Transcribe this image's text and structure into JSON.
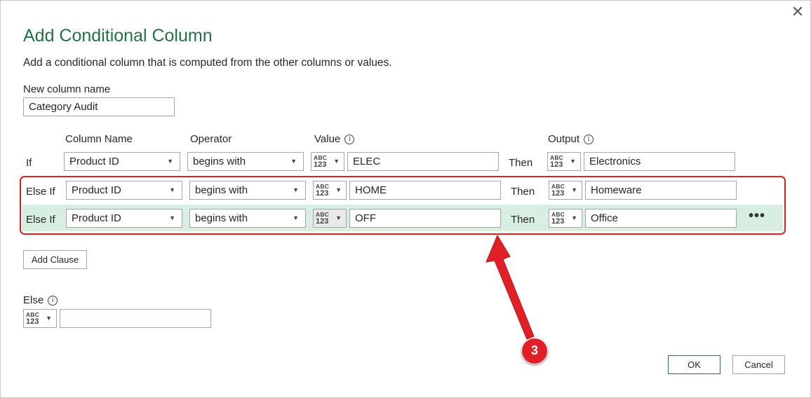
{
  "dialog": {
    "title": "Add Conditional Column",
    "subtitle": "Add a conditional column that is computed from the other columns or values.",
    "close_icon": "close-icon"
  },
  "new_column": {
    "label": "New column name",
    "value": "Category Audit"
  },
  "headers": {
    "column_name": "Column Name",
    "operator": "Operator",
    "value": "Value",
    "output": "Output",
    "info_glyph": "i"
  },
  "type_button": {
    "abc": "ABC",
    "num": "123"
  },
  "clauses": [
    {
      "prefix": "If",
      "column": "Product ID",
      "operator": "begins with",
      "value": "ELEC",
      "then": "Then",
      "output": "Electronics"
    },
    {
      "prefix": "Else If",
      "column": "Product ID",
      "operator": "begins with",
      "value": "HOME",
      "then": "Then",
      "output": "Homeware"
    },
    {
      "prefix": "Else If",
      "column": "Product ID",
      "operator": "begins with",
      "value": "OFF",
      "then": "Then",
      "output": "Office"
    }
  ],
  "more_options": "•••",
  "add_clause_label": "Add Clause",
  "else": {
    "label": "Else",
    "value": ""
  },
  "buttons": {
    "ok": "OK",
    "cancel": "Cancel"
  },
  "annotation": {
    "step_number": "3",
    "color": "#e21e26"
  },
  "colors": {
    "accent": "#217346",
    "highlight_row": "#d8eee2",
    "annotation_red": "#e02020"
  }
}
